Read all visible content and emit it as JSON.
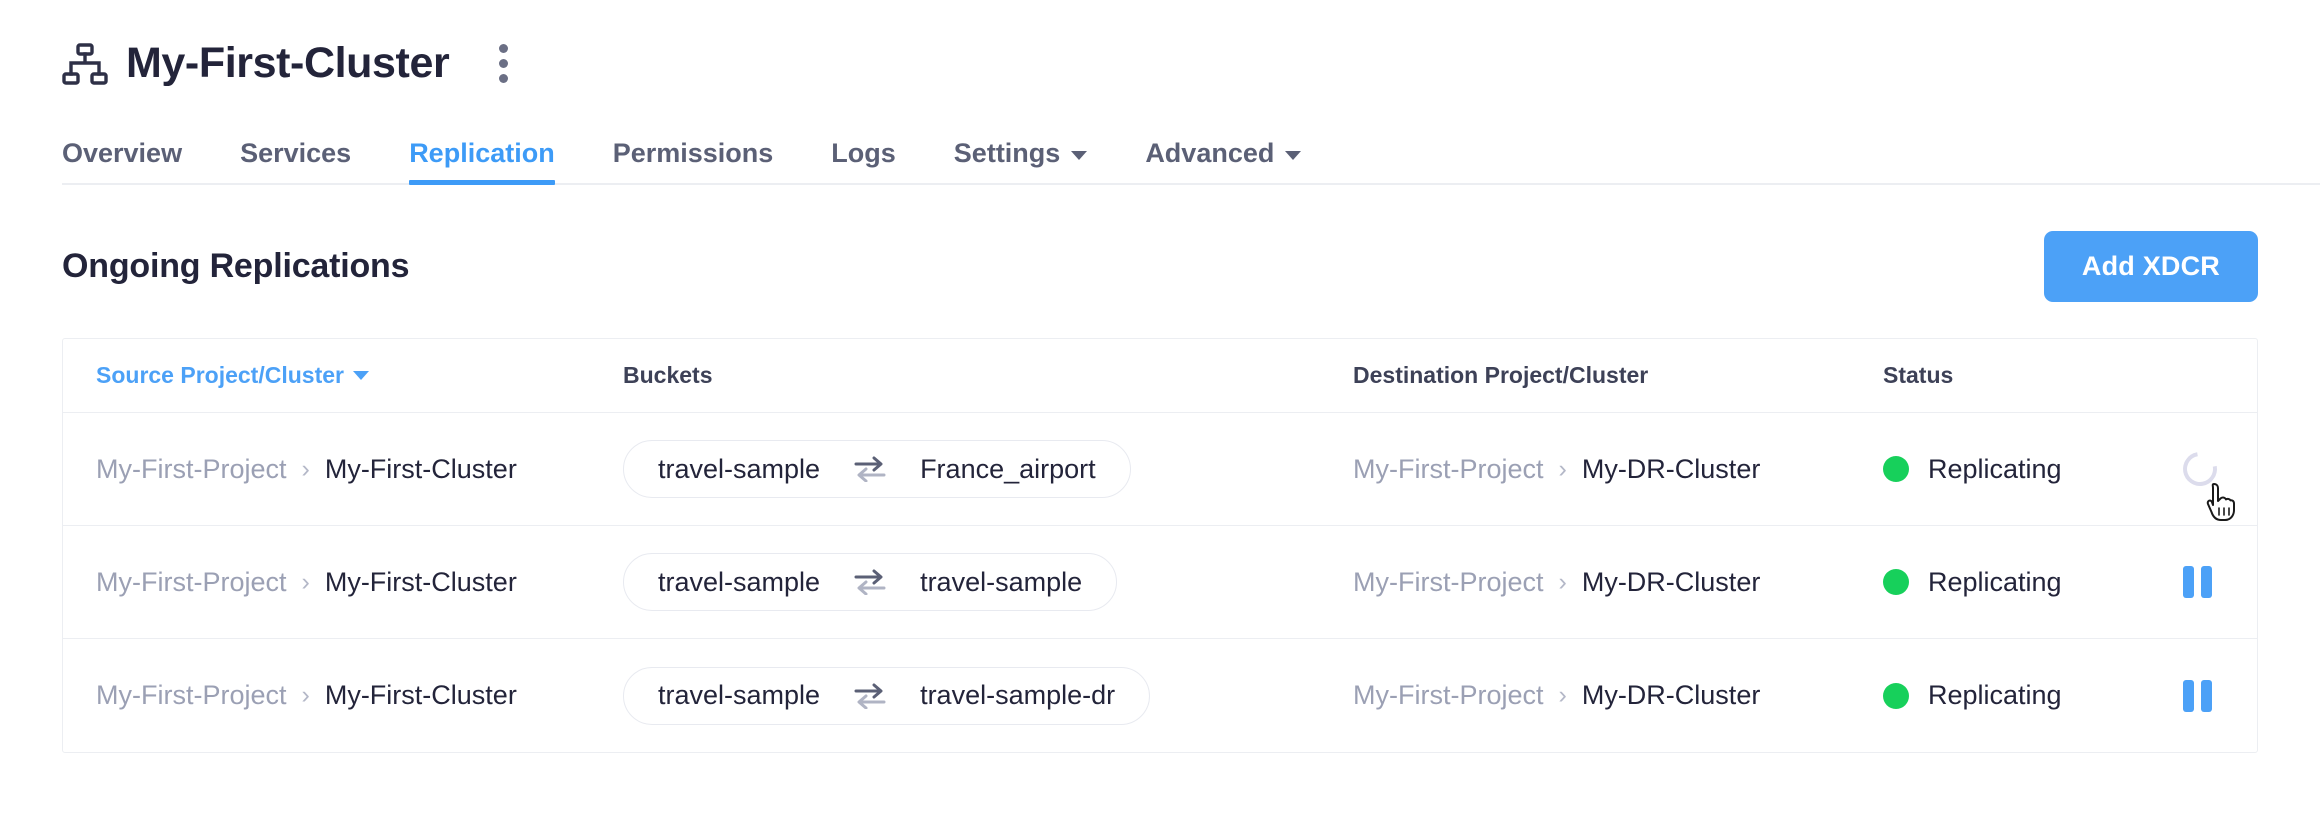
{
  "header": {
    "cluster_icon": "cluster-hierarchy-icon",
    "title": "My-First-Cluster",
    "kebab_icon": "kebab-menu-icon"
  },
  "tabs": [
    {
      "label": "Overview",
      "active": false,
      "has_chevron": false
    },
    {
      "label": "Services",
      "active": false,
      "has_chevron": false
    },
    {
      "label": "Replication",
      "active": true,
      "has_chevron": false
    },
    {
      "label": "Permissions",
      "active": false,
      "has_chevron": false
    },
    {
      "label": "Logs",
      "active": false,
      "has_chevron": false
    },
    {
      "label": "Settings",
      "active": false,
      "has_chevron": true
    },
    {
      "label": "Advanced",
      "active": false,
      "has_chevron": true
    }
  ],
  "section": {
    "title": "Ongoing Replications",
    "add_button_label": "Add XDCR"
  },
  "table": {
    "columns": {
      "source": "Source Project/Cluster",
      "source_sortable": true,
      "buckets": "Buckets",
      "destination": "Destination Project/Cluster",
      "status": "Status"
    },
    "rows": [
      {
        "source_project": "My-First-Project",
        "source_separator": "›",
        "source_cluster": "My-First-Cluster",
        "bucket_from": "travel-sample",
        "bucket_swap_icon": "swap-arrows-icon",
        "bucket_to": "France_airport",
        "dest_project": "My-First-Project",
        "dest_separator": "›",
        "dest_cluster": "My-DR-Cluster",
        "status": "Replicating",
        "status_color": "#17d05b",
        "action": "loading-spinner",
        "cursor_over_action": true
      },
      {
        "source_project": "My-First-Project",
        "source_separator": "›",
        "source_cluster": "My-First-Cluster",
        "bucket_from": "travel-sample",
        "bucket_swap_icon": "swap-arrows-icon",
        "bucket_to": "travel-sample",
        "dest_project": "My-First-Project",
        "dest_separator": "›",
        "dest_cluster": "My-DR-Cluster",
        "status": "Replicating",
        "status_color": "#17d05b",
        "action": "pause-button",
        "cursor_over_action": false
      },
      {
        "source_project": "My-First-Project",
        "source_separator": "›",
        "source_cluster": "My-First-Cluster",
        "bucket_from": "travel-sample",
        "bucket_swap_icon": "swap-arrows-icon",
        "bucket_to": "travel-sample-dr",
        "dest_project": "My-First-Project",
        "dest_separator": "›",
        "dest_cluster": "My-DR-Cluster",
        "status": "Replicating",
        "status_color": "#17d05b",
        "action": "pause-button",
        "cursor_over_action": false
      }
    ]
  },
  "colors": {
    "accent": "#4ca1f7",
    "tab_active": "#3d9bf7",
    "text_dark": "#23243a",
    "text_muted": "#9ba0b4",
    "status_green": "#17d05b",
    "border": "#eceef2"
  }
}
